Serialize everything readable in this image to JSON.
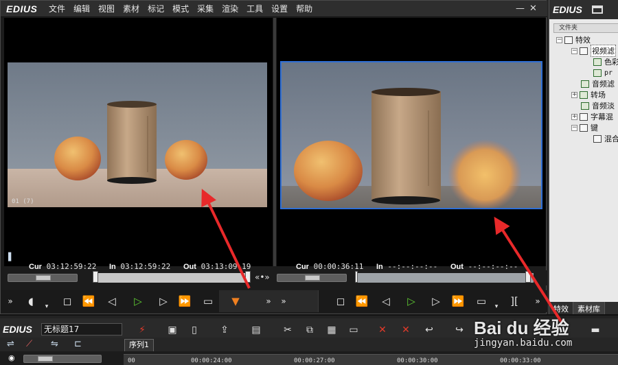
{
  "app": {
    "logo": "EDIUS",
    "menu": [
      "文件",
      "编辑",
      "视图",
      "素材",
      "标记",
      "模式",
      "采集",
      "渲染",
      "工具",
      "设置",
      "帮助"
    ],
    "minimize": "—",
    "close": "✕"
  },
  "player": {
    "frame_tag": "01 (7)",
    "cur_label": "Cur",
    "cur": "03:12:59:22",
    "in_label": "In",
    "in": "03:12:59:22",
    "out_label": "Out",
    "out": "03:13:09:19"
  },
  "recorder": {
    "cur_label": "Cur",
    "cur": "00:00:36:11",
    "in_label": "In",
    "in": "--:--:--:--",
    "out_label": "Out",
    "out": "--:--:--:--"
  },
  "side_panel": {
    "logo": "EDIUS",
    "folder_header": "文件夹",
    "tree": [
      "特效",
      "视频滤",
      "色彩",
      "pr",
      "音频滤",
      "转场",
      "音频淡",
      "字幕混",
      "键",
      "混合"
    ],
    "tabs": [
      "特效",
      "素材库"
    ]
  },
  "timeline": {
    "logo": "EDIUS",
    "project_name": "无标题17",
    "sequence_tab": "序列1",
    "ruler": [
      "00",
      "00:00:24:00",
      "00:00:27:00",
      "00:00:30:00",
      "00:00:33:00"
    ]
  },
  "watermark": {
    "brand": "Bai du 经验",
    "url": "jingyan.baidu.com"
  },
  "colors": {
    "arrow": "#e8292a",
    "selection_border": "#2f6fd6",
    "play": "#5fcc32"
  }
}
